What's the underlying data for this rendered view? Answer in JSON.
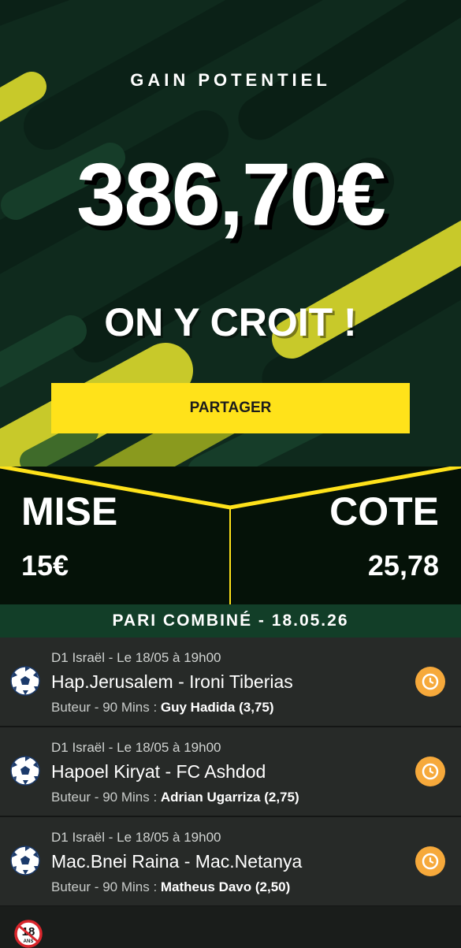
{
  "hero": {
    "label": "GAIN POTENTIEL",
    "amount": "386,70€",
    "slogan": "ON Y CROIT !",
    "share_label": "PARTAGER"
  },
  "stats": {
    "stake_label": "MISE",
    "stake_value": "15€",
    "odds_label": "COTE",
    "odds_value": "25,78"
  },
  "combo": {
    "title": "PARI COMBINÉ - 18.05.26"
  },
  "bets": [
    {
      "meta": "D1 Israël - Le 18/05 à 19h00",
      "match": "Hap.Jerusalem - Ironi Tiberias",
      "market": "Buteur - 90 Mins : ",
      "selection": "Guy Hadida (3,75)"
    },
    {
      "meta": "D1 Israël - Le 18/05 à 19h00",
      "match": "Hapoel Kiryat - FC Ashdod",
      "market": "Buteur - 90 Mins : ",
      "selection": "Adrian Ugarriza (2,75)"
    },
    {
      "meta": "D1 Israël - Le 18/05 à 19h00",
      "match": "Mac.Bnei Raina - Mac.Netanya",
      "market": "Buteur - 90 Mins : ",
      "selection": "Matheus Davo (2,50)"
    }
  ],
  "footer": {
    "age_label": "18",
    "age_sub": "ANS"
  },
  "colors": {
    "accent_yellow": "#ffe21a",
    "dark_green": "#0f2a1d",
    "header_green": "#123e28",
    "clock_orange": "#f6a93b"
  },
  "icons": [
    "soccer-ball-icon",
    "clock-icon",
    "age-restriction-icon"
  ]
}
